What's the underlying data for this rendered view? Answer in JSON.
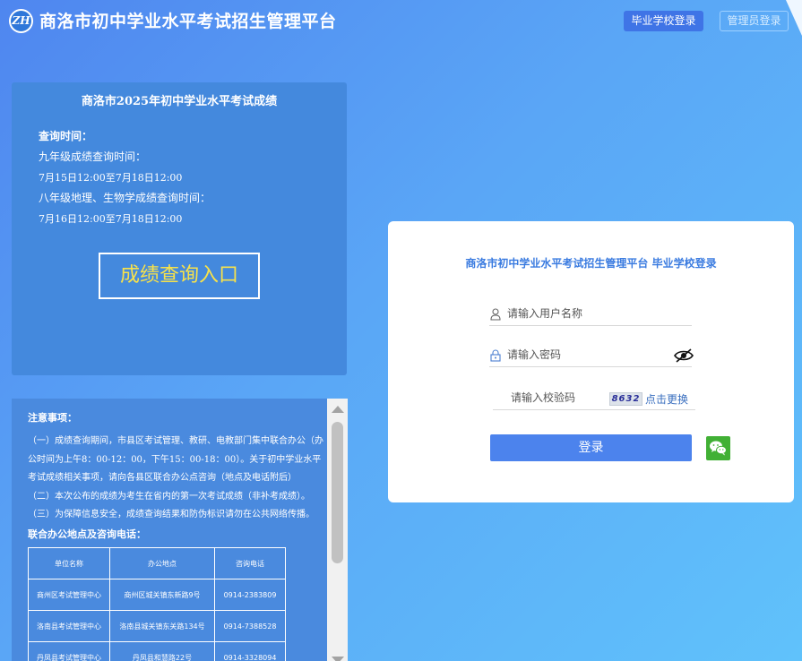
{
  "header": {
    "logo_text": "ZH",
    "title": "商洛市初中学业水平考试招生管理平台",
    "school_login": "毕业学校登录",
    "admin_login": "管理员登录"
  },
  "score_panel": {
    "title": "商洛市2025年初中学业水平考试成绩",
    "query_label": "查询时间：",
    "line1": "九年级成绩查询时间：",
    "time1": "7月15日12:00至7月18日12:00",
    "line2": "八年级地理、生物学成绩查询时间：",
    "time2": "7月16日12:00至7月18日12:00",
    "entry_button": "成绩查询入口"
  },
  "notice": {
    "title": "注意事项：",
    "paragraphs": [
      "（一）成绩查询期间，市县区考试管理、教研、电教部门集中联合办公（办公时间为上午8：00-12：00，下午15：00-18：00）。关于初中学业水平考试成绩相关事项，请向各县区联合办公点咨询（地点及电话附后）",
      "（二）本次公布的成绩为考生在省内的第一次考试成绩（非补考成绩）。",
      "（三）为保障信息安全，成绩查询结果和防伪标识请勿在公共网络传播。"
    ],
    "contact_title": "联合办公地点及咨询电话：",
    "table": {
      "headers": [
        "单位名称",
        "办公地点",
        "咨询电话"
      ],
      "rows": [
        [
          "商州区考试管理中心",
          "商州区城关镇东新路9号",
          "0914-2383809"
        ],
        [
          "洛南县考试管理中心",
          "洛南县城关镇东关路134号",
          "0914-7388528"
        ],
        [
          "丹凤县考试管理中心",
          "丹凤县和慧路22号",
          "0914-3328094"
        ]
      ]
    }
  },
  "login": {
    "title": "商洛市初中学业水平考试招生管理平台 毕业学校登录",
    "username_placeholder": "请输入用户名称",
    "password_placeholder": "请输入密码",
    "captcha_placeholder": "请输入校验码",
    "captcha_text": "8632",
    "refresh_label": "点击更换",
    "submit_label": "登录"
  }
}
